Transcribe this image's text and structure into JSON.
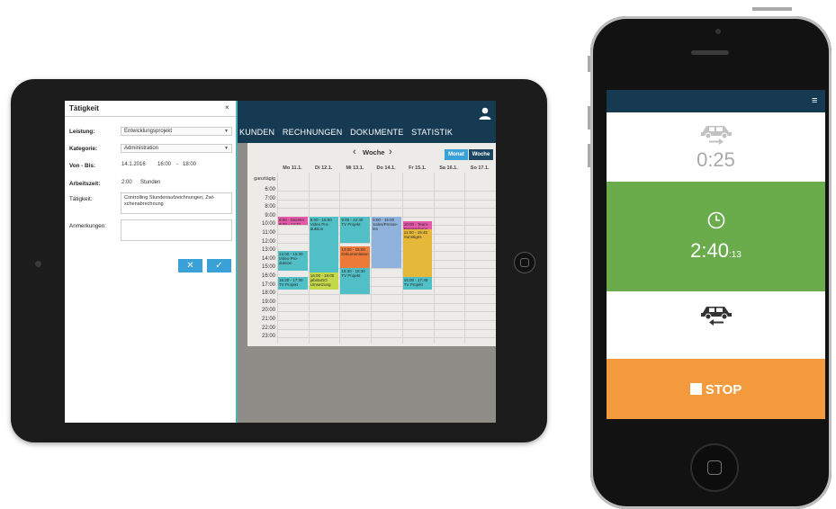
{
  "tablet": {
    "nav_links": [
      "KUNDEN",
      "RECHNUNGEN",
      "DOKUMENTE",
      "STATISTIK"
    ],
    "calendar": {
      "title": "Woche",
      "view_buttons": {
        "month": "Monat",
        "week": "Woche"
      },
      "allday_label": "ganztägig",
      "days": [
        "Mo 11.1.",
        "Di 12.1.",
        "Mi 13.1.",
        "Do 14.1.",
        "Fr 15.1.",
        "Sa 16.1.",
        "So 17.1."
      ],
      "hours": [
        "6:00",
        "7:00",
        "8:00",
        "9:00",
        "10:00",
        "11:00",
        "12:00",
        "13:00",
        "14:00",
        "15:00",
        "16:00",
        "17:00",
        "18:00",
        "19:00",
        "20:00",
        "21:00",
        "22:00",
        "23:00"
      ],
      "events": [
        {
          "day": 0,
          "start": 9.0,
          "end": 10.0,
          "text": "9:00 - Daimler 9:30 - 13:30 Video Pro-duktion",
          "color": "#e45aa8"
        },
        {
          "day": 0,
          "start": 13.0,
          "end": 15.3,
          "text": "13:00 - 15:30 Video Pro-duktion",
          "color": "#50bfc6"
        },
        {
          "day": 0,
          "start": 16.0,
          "end": 17.5,
          "text": "16:30 - 17:30 TV Projekt",
          "color": "#50bfc6"
        },
        {
          "day": 1,
          "start": 9.0,
          "end": 15.5,
          "text": "9:00 - 15:00 Video Pro-duktion",
          "color": "#50bfc6"
        },
        {
          "day": 1,
          "start": 15.5,
          "end": 17.5,
          "text": "16:00 - 18:00 jabstaGO Umsetzung",
          "color": "#c4d94a"
        },
        {
          "day": 2,
          "start": 9.0,
          "end": 12.0,
          "text": "9:00 - 12:30 TV Projekt",
          "color": "#50bfc6"
        },
        {
          "day": 2,
          "start": 12.5,
          "end": 15.0,
          "text": "13:00 - 15:00 Dokumentation",
          "color": "#ee7a3a"
        },
        {
          "day": 2,
          "start": 15.0,
          "end": 18.0,
          "text": "15:30 - 18:30 TV Projekt",
          "color": "#50bfc6"
        },
        {
          "day": 3,
          "start": 9.0,
          "end": 15.0,
          "text": "9:00 - 15:00 Sales/Presse-les",
          "color": "#8fb3dc"
        },
        {
          "day": 4,
          "start": 9.5,
          "end": 10.5,
          "text": "10:00 - Team-Besprechung",
          "color": "#e45aa8"
        },
        {
          "day": 4,
          "start": 10.5,
          "end": 16.0,
          "text": "11:00 - 15:45 Sonstiges",
          "color": "#e5b83a"
        },
        {
          "day": 4,
          "start": 16.0,
          "end": 17.5,
          "text": "16:00 - 17:45 TV Projekt",
          "color": "#50bfc6"
        }
      ]
    },
    "form": {
      "title": "Tätigkeit",
      "close": "×",
      "leistung_label": "Leistung:",
      "leistung_value": "Entwicklungsprojekt",
      "kategorie_label": "Kategorie:",
      "kategorie_value": "Administration",
      "vonbis_label": "Von - Bis:",
      "date": "14.1.2016",
      "from": "16:00",
      "dash": "-",
      "to": "18:00",
      "arbeitszeit_label": "Arbeitszeit:",
      "arbeitszeit_value": "2:00",
      "arbeitszeit_unit": "Stunden",
      "taetigkeit_label": "Tätigkeit:",
      "taetigkeit_value": "Controlling Stundenaufzeichnungen, Zwi-schenabrechnung",
      "anmerkungen_label": "Anmerkungen:",
      "cancel_icon": "✕",
      "ok_icon": "✓"
    }
  },
  "phone": {
    "menu_icon": "≡",
    "drive_time": "0:25",
    "work_time": "2:40",
    "work_seconds": ":13",
    "stop_label": "STOP"
  }
}
